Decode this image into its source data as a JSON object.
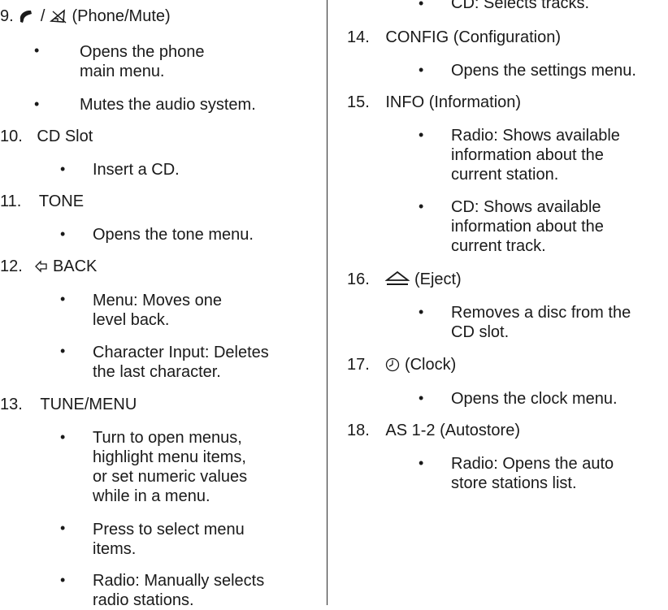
{
  "left_column": {
    "item9": {
      "number": "9.",
      "separator": "/",
      "label": "(Phone/Mute)",
      "bullets": [
        {
          "lines": [
            "Opens the phone",
            "main menu."
          ]
        },
        {
          "lines": [
            "Mutes the audio system."
          ]
        }
      ]
    },
    "item10": {
      "number": "10.",
      "label": "CD Slot",
      "bullets": [
        {
          "lines": [
            "Insert a CD."
          ]
        }
      ]
    },
    "item11": {
      "number": "11.",
      "label": "TONE",
      "bullets": [
        {
          "lines": [
            "Opens the tone menu."
          ]
        }
      ]
    },
    "item12": {
      "number": "12.",
      "label": "BACK",
      "bullets": [
        {
          "lines": [
            "Menu: Moves one",
            "level back."
          ]
        },
        {
          "lines": [
            "Character Input: Deletes",
            "the last character."
          ]
        }
      ]
    },
    "item13": {
      "number": "13.",
      "label": "TUNE/MENU",
      "bullets": [
        {
          "lines": [
            "Turn to open menus,",
            "highlight menu items,",
            "or set numeric values",
            "while in a menu."
          ]
        },
        {
          "lines": [
            "Press to select menu",
            "items."
          ]
        },
        {
          "lines": [
            "Radio: Manually selects",
            "radio stations."
          ]
        }
      ]
    }
  },
  "right_column": {
    "item13_cont": {
      "bullets": [
        {
          "lines": [
            "CD: Selects tracks."
          ]
        }
      ]
    },
    "item14": {
      "number": "14.",
      "label": "CONFIG (Configuration)",
      "bullets": [
        {
          "lines": [
            "Opens the settings menu."
          ]
        }
      ]
    },
    "item15": {
      "number": "15.",
      "label": "INFO (Information)",
      "bullets": [
        {
          "lines": [
            "Radio: Shows available",
            "information about the",
            "current station."
          ]
        },
        {
          "lines": [
            "CD: Shows available",
            "information about the",
            "current track."
          ]
        }
      ]
    },
    "item16": {
      "number": "16.",
      "label": "(Eject)",
      "bullets": [
        {
          "lines": [
            "Removes a disc from the",
            "CD slot."
          ]
        }
      ]
    },
    "item17": {
      "number": "17.",
      "label": "(Clock)",
      "bullets": [
        {
          "lines": [
            "Opens the clock menu."
          ]
        }
      ]
    },
    "item18": {
      "number": "18.",
      "label": "AS 1-2 (Autostore)",
      "bullets": [
        {
          "lines": [
            "Radio: Opens the auto",
            "store stations list."
          ]
        }
      ]
    }
  },
  "icons": {
    "item9_icons": [
      "phone-icon",
      "mute-icon"
    ],
    "item12_icon": "back-arrow-icon",
    "item16_icon": "eject-icon",
    "item17_icon": "clock-icon"
  },
  "colors": {
    "text": "#1a1a1a",
    "divider": "#2a2a2a"
  }
}
